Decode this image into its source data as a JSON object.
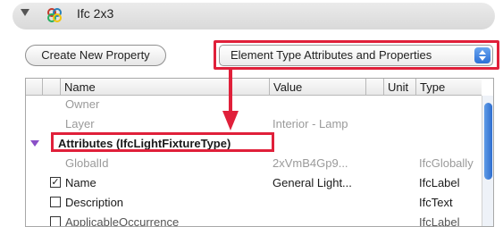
{
  "title_bar": {
    "title": "Ifc 2x3",
    "icon": "ifc-logo-icon"
  },
  "toolbar": {
    "create_button_label": "Create New Property",
    "popup_selected": "Element Type Attributes and Properties"
  },
  "table": {
    "columns": [
      "Name",
      "Value",
      "Unit",
      "Type"
    ],
    "rows": [
      {
        "name": "Owner",
        "value": "",
        "type": "",
        "greyed": true
      },
      {
        "name": "Layer",
        "value": "Interior - Lamp",
        "type": "",
        "greyed": true
      },
      {
        "name": "Attributes (IfcLightFixtureType)",
        "value": "",
        "type": "",
        "group": true
      },
      {
        "name": "GlobalId",
        "value": "2xVmB4Gp9...",
        "type": "IfcGlobally",
        "greyed": true
      },
      {
        "name": "Name",
        "value": "General Light...",
        "type": "IfcLabel",
        "checked": true
      },
      {
        "name": "Description",
        "value": "",
        "type": "IfcText",
        "checked": false
      },
      {
        "name": "ApplicableOccurrence",
        "value": "",
        "type": "IfcLabel",
        "checked": false
      }
    ]
  },
  "colors": {
    "highlight": "#e0203a",
    "group_triangle": "#8a4fc7",
    "accent": "#2f6fcf"
  }
}
